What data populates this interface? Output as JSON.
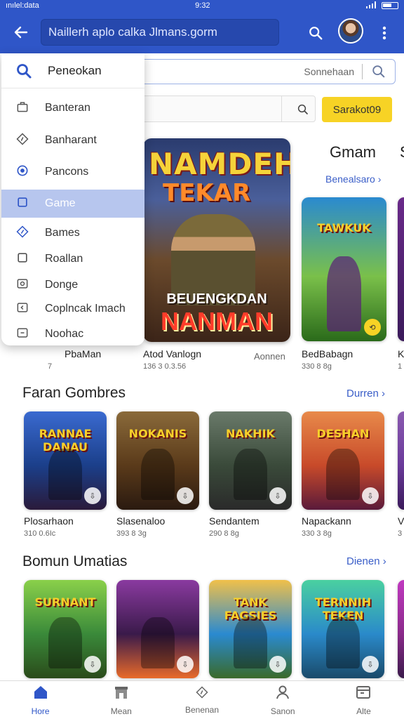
{
  "status_bar": {
    "left": "ınılel:data",
    "time": "9:32"
  },
  "app_bar": {
    "url": "Naillerh aplo calka Jlmans.gorm"
  },
  "search": {
    "placeholder": "Sonnehaan"
  },
  "filter": {
    "button_label": "Sarakot09"
  },
  "menu": {
    "header": "Peneokan",
    "items": [
      {
        "label": "Banteran",
        "icon": "bag-icon",
        "active": false
      },
      {
        "label": "Banharant",
        "icon": "tag-icon",
        "active": false
      },
      {
        "label": "Pancons",
        "icon": "record-icon",
        "active": false
      },
      {
        "label": "Game",
        "icon": "square-icon",
        "active": true
      },
      {
        "label": "Bames",
        "icon": "diamond-icon",
        "active": false
      },
      {
        "label": "Roallan",
        "icon": "square-icon",
        "active": false
      },
      {
        "label": "Donge",
        "icon": "circle-box-icon",
        "active": false
      },
      {
        "label": "Coplncak Imach",
        "icon": "back-box-icon",
        "active": false
      },
      {
        "label": "Noohac",
        "icon": "minus-box-icon",
        "active": false
      }
    ]
  },
  "featured": {
    "title_top": "NAMDEH",
    "title_mid": "TEKAR",
    "title_bottom_1": "BEUENGKDAN",
    "title_bottom_2": "NANMAN"
  },
  "row1": {
    "heading": "Gmam",
    "heading_partial": "S",
    "link": "Benealsaro",
    "games": [
      {
        "name": "PbaMan",
        "meta": "7",
        "art": ""
      },
      {
        "name": "Atod Vanlogn",
        "meta": "136 3 0.3.56",
        "extra": "Aonnen",
        "art": ""
      },
      {
        "name": "BedBabagn",
        "meta": "330 8 8g",
        "art": "TAWKUK"
      },
      {
        "name": "K",
        "meta": "1",
        "art": ""
      }
    ]
  },
  "row2": {
    "heading": "Faran Gombres",
    "link": "Durren",
    "games": [
      {
        "name": "Plosarhaon",
        "meta": "310 0.6Ic",
        "art": "RANNAE DANAU",
        "colors": [
          "#1b3f8a",
          "#3a6ad0",
          "#2a1a3a"
        ]
      },
      {
        "name": "Slasenaloo",
        "meta": "393 8 3g",
        "art": "NOKANIS",
        "colors": [
          "#5a3a1a",
          "#8a6a3a",
          "#2a1a10"
        ]
      },
      {
        "name": "Sendantem",
        "meta": "290 8 8g",
        "art": "NAKHIK",
        "colors": [
          "#3a4a3a",
          "#6a7a6a",
          "#2a2a2a"
        ]
      },
      {
        "name": "Napackann",
        "meta": "330 3 8g",
        "art": "DESHAN",
        "colors": [
          "#c84a2a",
          "#e88a4a",
          "#5a1a3a"
        ]
      },
      {
        "name": "V",
        "meta": "3",
        "art": "",
        "colors": [
          "#6a3a9a",
          "#8a5ab0",
          "#3a1a5a"
        ]
      }
    ]
  },
  "row3": {
    "heading": "Bomun Umatias",
    "link": "Dienen",
    "games": [
      {
        "name": "",
        "meta": "",
        "art": "SURNANT",
        "colors": [
          "#3a8a3a",
          "#8ad04a",
          "#2a4a1a"
        ]
      },
      {
        "name": "",
        "meta": "",
        "art": "",
        "colors": [
          "#3a1a4a",
          "#8a3aa0",
          "#e86a2a"
        ]
      },
      {
        "name": "",
        "meta": "",
        "art": "TANK FAGSIES",
        "colors": [
          "#2a8ad0",
          "#f0c04a",
          "#3a6a2a"
        ]
      },
      {
        "name": "",
        "meta": "",
        "art": "TERNNIH TEKEN",
        "colors": [
          "#2a8aca",
          "#4ad0a0",
          "#1a4a6a"
        ]
      },
      {
        "name": "",
        "meta": "",
        "art": "",
        "colors": [
          "#8a2a8a",
          "#c03ac0",
          "#3a1a4a"
        ]
      }
    ]
  },
  "bottom_nav": [
    {
      "label": "Hore",
      "icon": "home-icon",
      "active": true
    },
    {
      "label": "Mean",
      "icon": "store-icon",
      "active": false
    },
    {
      "label": "Benenan",
      "icon": "tag-icon",
      "active": false
    },
    {
      "label": "Sanon",
      "icon": "person-icon",
      "active": false
    },
    {
      "label": "Alte",
      "icon": "window-icon",
      "active": false
    }
  ],
  "colors": {
    "primary": "#2f56c8",
    "accent": "#f7d325",
    "link": "#3a5ec8",
    "menu_active": "#b7c6ee"
  }
}
